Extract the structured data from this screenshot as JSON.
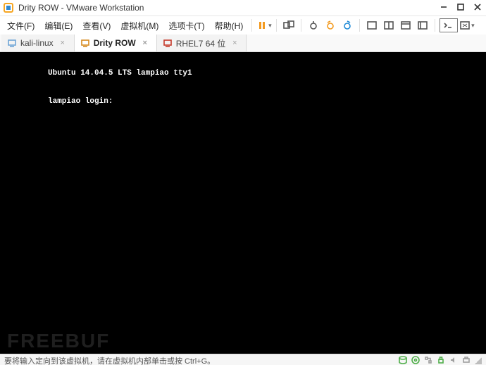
{
  "titlebar": {
    "title": "Drity ROW - VMware Workstation"
  },
  "menu": {
    "items": [
      {
        "label": "文件(F)"
      },
      {
        "label": "编辑(E)"
      },
      {
        "label": "查看(V)"
      },
      {
        "label": "虚拟机(M)"
      },
      {
        "label": "选项卡(T)"
      },
      {
        "label": "帮助(H)"
      }
    ]
  },
  "toolbar": {
    "pause_color": "#f39a1e",
    "accent_blue": "#1f8ad6"
  },
  "vmtabs": {
    "items": [
      {
        "label": "kali-linux",
        "active": false
      },
      {
        "label": "Drity ROW",
        "active": true
      },
      {
        "label": "RHEL7 64 位",
        "active": false
      }
    ]
  },
  "terminal": {
    "line1": "Ubuntu 14.04.5 LTS lampiao tty1",
    "line2": "lampiao login:"
  },
  "statusbar": {
    "message": "要将输入定向到该虚拟机，请在虚拟机内部单击或按 Ctrl+G。"
  },
  "watermark": "FREEBUF"
}
